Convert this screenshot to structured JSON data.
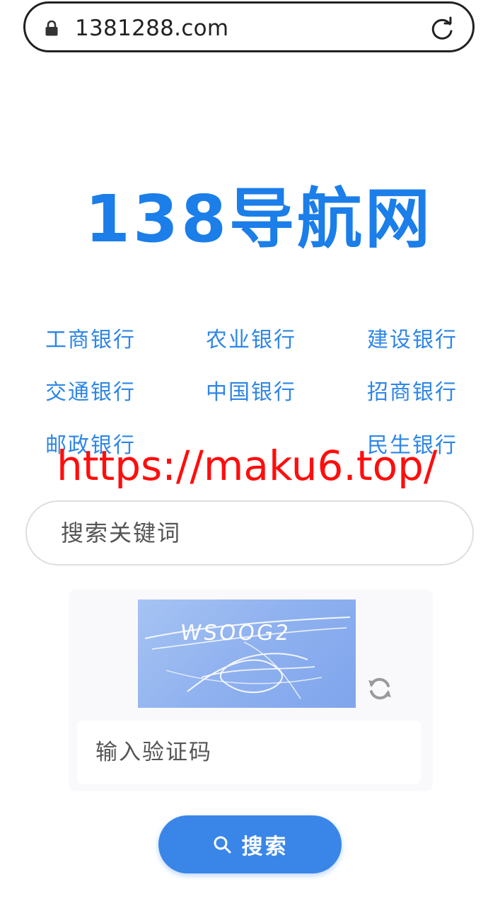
{
  "browser": {
    "url": "1381288.com",
    "lock_icon": "lock-icon",
    "reload_icon": "reload-icon"
  },
  "logo": {
    "text": "138导航网",
    "color": "#1b7ee9"
  },
  "banks": [
    {
      "label": "工商银行"
    },
    {
      "label": "农业银行"
    },
    {
      "label": "建设银行"
    },
    {
      "label": "交通银行"
    },
    {
      "label": "中国银行"
    },
    {
      "label": "招商银行"
    },
    {
      "label": "邮政银行"
    },
    {
      "label": "民生银行"
    }
  ],
  "watermark": {
    "text": "https://maku6.top/",
    "color": "#ff0d0d"
  },
  "search": {
    "placeholder": "搜索关键词",
    "value": ""
  },
  "captcha": {
    "code": "WSOOG2",
    "input_placeholder": "输入验证码",
    "refresh_icon": "refresh-icon"
  },
  "search_button": {
    "label": "搜索",
    "icon": "search-icon",
    "color": "#3a86e8"
  },
  "colors": {
    "link": "#2e86e6",
    "accent": "#3a86e8"
  }
}
